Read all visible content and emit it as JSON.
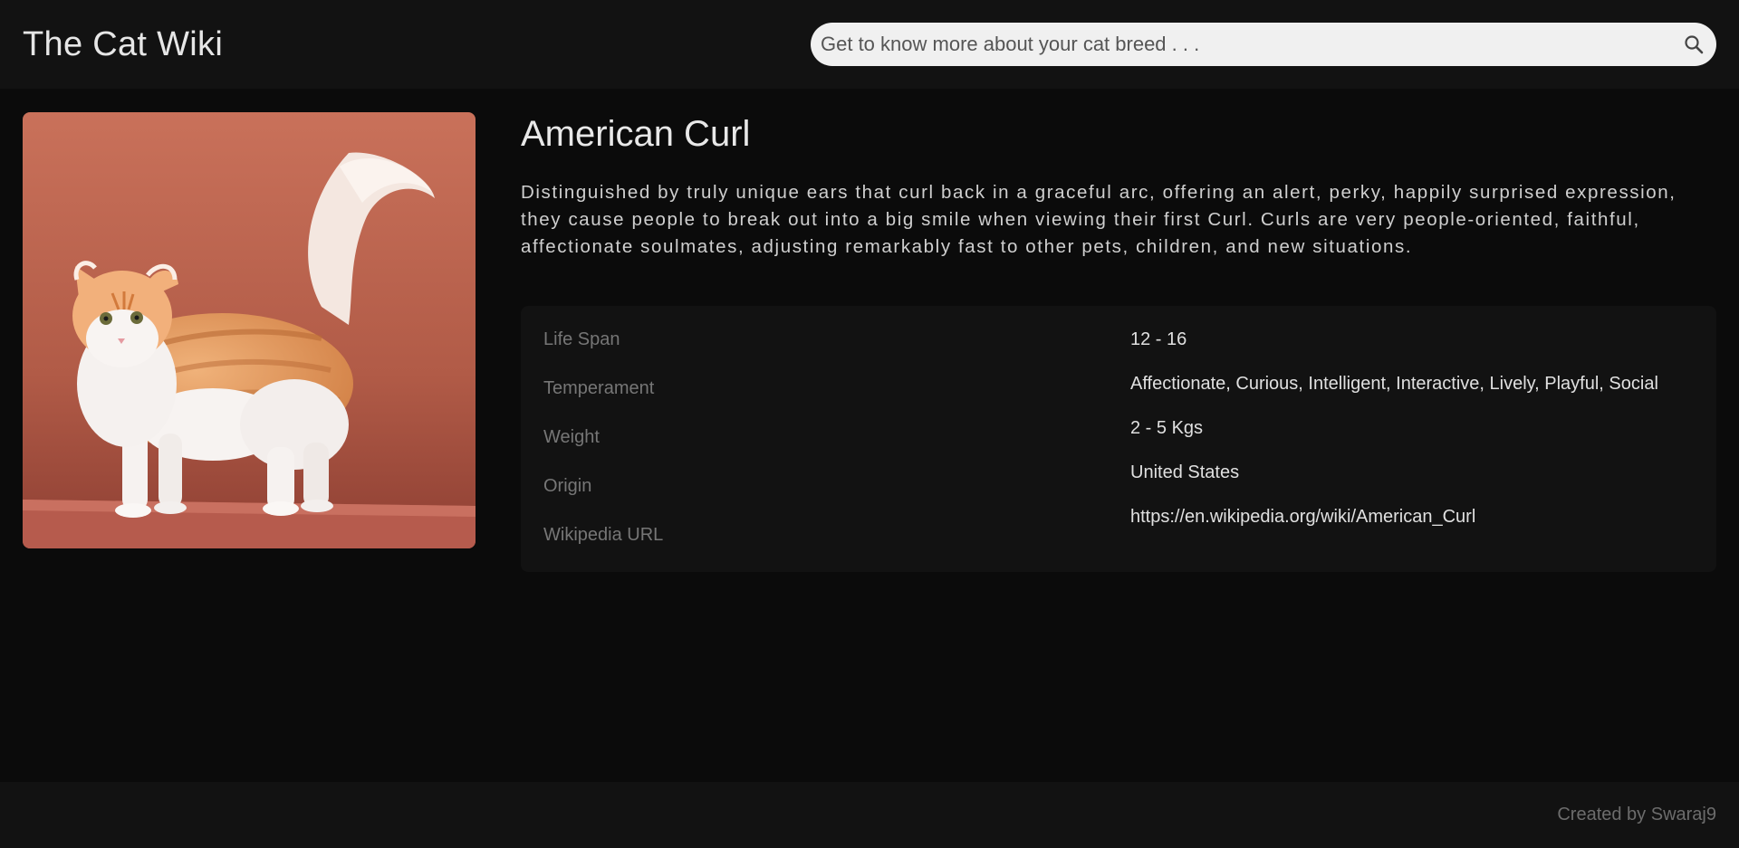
{
  "header": {
    "title": "The Cat Wiki",
    "search_placeholder": "Get to know more about your cat breed . . ."
  },
  "breed": {
    "name": "American Curl",
    "description": "Distinguished by truly unique ears that curl back in a graceful arc, offering an alert, perky, happily surprised expression, they cause people to break out into a big smile when viewing their first Curl. Curls are very people-oriented, faithful, affectionate soulmates, adjusting remarkably fast to other pets, children, and new situations.",
    "image_alt": "American Curl cat",
    "info": {
      "labels": {
        "life_span": "Life Span",
        "temperament": "Temperament",
        "weight": "Weight",
        "origin": "Origin",
        "wikipedia": "Wikipedia URL"
      },
      "values": {
        "life_span": "12 - 16",
        "temperament": "Affectionate, Curious, Intelligent, Interactive, Lively, Playful, Social",
        "weight": "2 - 5 Kgs",
        "origin": "United States",
        "wikipedia": "https://en.wikipedia.org/wiki/American_Curl"
      }
    }
  },
  "footer": {
    "credit": "Created by Swaraj9"
  },
  "colors": {
    "background": "#0b0b0b",
    "panel": "#121212",
    "search_bg": "#f0f0f0",
    "label": "#767676",
    "value": "#e0e0e0"
  }
}
